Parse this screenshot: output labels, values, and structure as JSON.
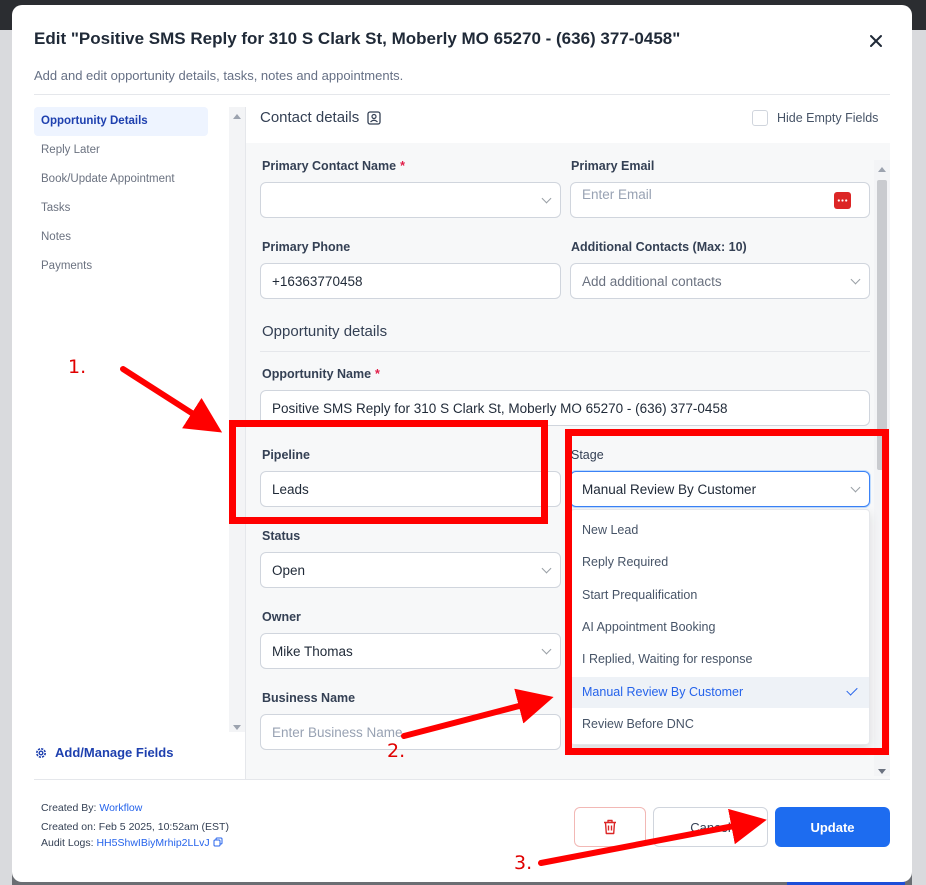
{
  "modal": {
    "title": "Edit \"Positive SMS Reply for 310 S Clark St, Moberly MO 65270 - (636) 377-0458\"",
    "subtitle": "Add and edit opportunity details, tasks, notes and appointments."
  },
  "sidebar": {
    "items": [
      {
        "label": "Opportunity Details",
        "active": true
      },
      {
        "label": "Reply Later"
      },
      {
        "label": "Book/Update Appointment"
      },
      {
        "label": "Tasks"
      },
      {
        "label": "Notes"
      },
      {
        "label": "Payments"
      }
    ],
    "add_manage_label": "Add/Manage Fields"
  },
  "contact": {
    "header": "Contact details",
    "hide_empty_label": "Hide Empty Fields",
    "primary_contact_label": "Primary Contact Name",
    "primary_contact_value": "",
    "primary_email_label": "Primary Email",
    "primary_email_placeholder": "Enter Email",
    "primary_phone_label": "Primary Phone",
    "primary_phone_value": "+16363770458",
    "additional_contacts_label": "Additional Contacts (Max: 10)",
    "additional_contacts_placeholder": "Add additional contacts"
  },
  "opportunity": {
    "header": "Opportunity details",
    "name_label": "Opportunity Name",
    "name_value": "Positive SMS Reply for 310 S Clark St, Moberly MO 65270 - (636) 377-0458",
    "pipeline_label": "Pipeline",
    "pipeline_value": "Leads",
    "stage_label": "Stage",
    "stage_value": "Manual Review By Customer",
    "status_label": "Status",
    "status_value": "Open",
    "owner_label": "Owner",
    "owner_value": "Mike Thomas",
    "business_label": "Business Name",
    "business_placeholder": "Enter Business Name"
  },
  "stage_options": [
    "New Lead",
    "Reply Required",
    "Start Prequalification",
    "AI Appointment Booking",
    "I Replied, Waiting for response",
    "Manual Review By Customer",
    "Review Before DNC"
  ],
  "stage_selected_index": 5,
  "footer": {
    "created_by_label": "Created By:",
    "created_by_value": "Workflow",
    "created_on_label": "Created on:",
    "created_on_value": "Feb 5 2025, 10:52am (EST)",
    "audit_label": "Audit Logs:",
    "audit_value": "HH5ShwIBiyMrhip2LLvJ",
    "cancel_label": "Cancel",
    "update_label": "Update"
  },
  "annotations": {
    "step1": "1.",
    "step2": "2.",
    "step3": "3."
  },
  "colors": {
    "primary": "#1d6cf0",
    "annotation_red": "#ff0000",
    "delete_red": "#dc2626"
  }
}
